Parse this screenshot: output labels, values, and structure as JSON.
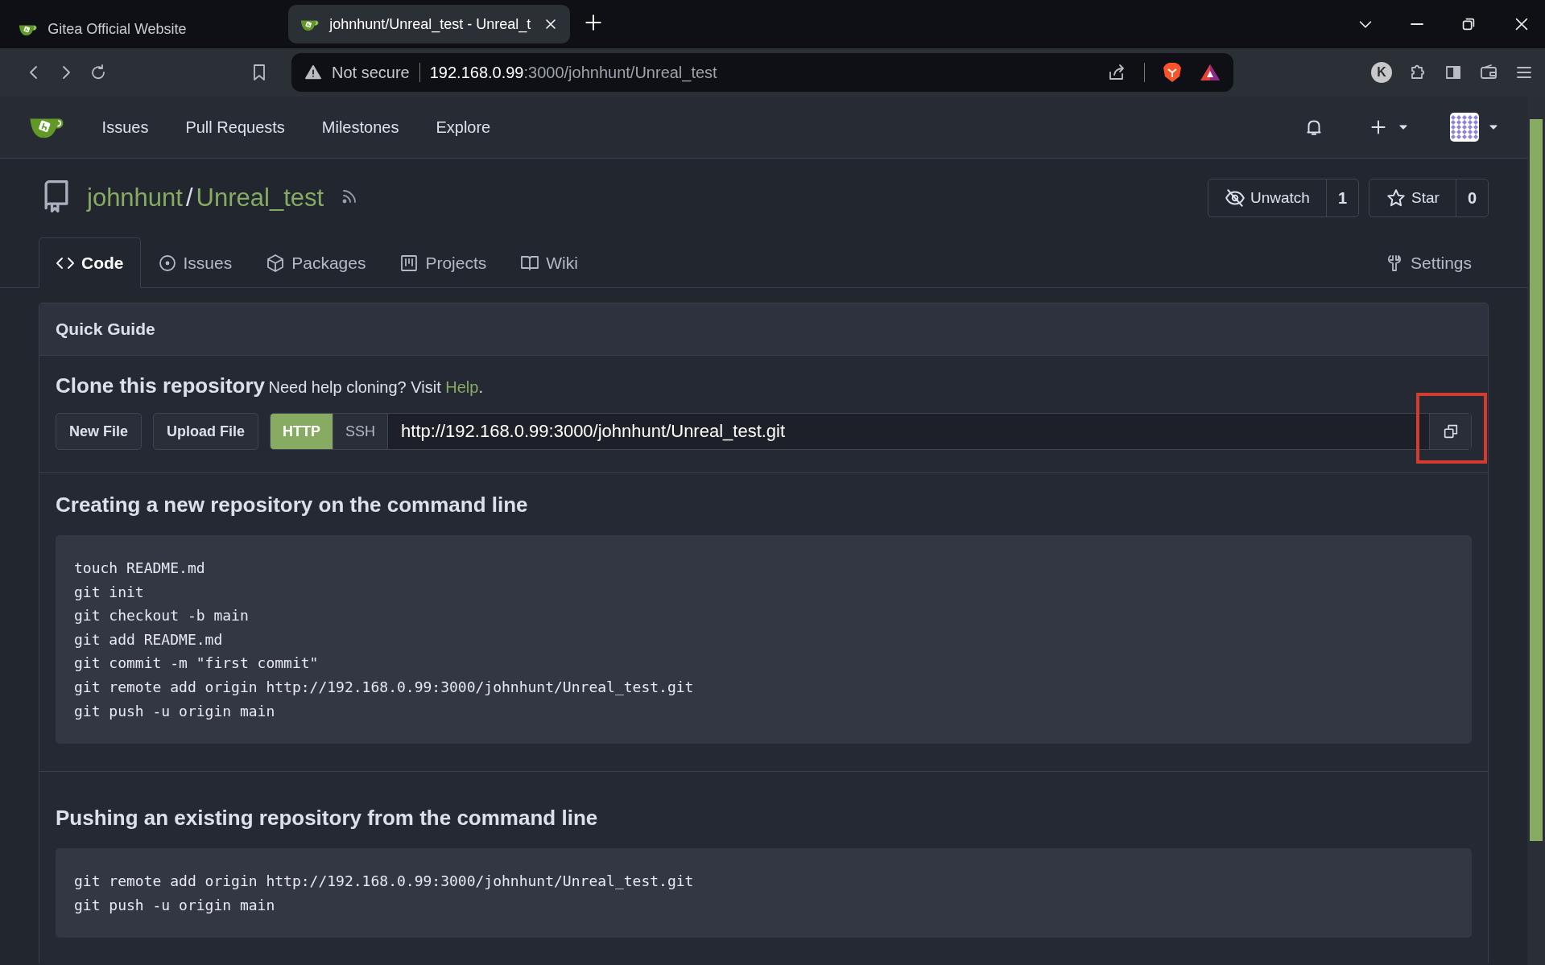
{
  "browser": {
    "tabs": [
      {
        "title": "Gitea Official Website",
        "selected": false
      },
      {
        "title": "johnhunt/Unreal_test - Unreal_t",
        "selected": true
      }
    ],
    "address": {
      "warning": "Not secure",
      "host": "192.168.0.99",
      "path": ":3000/johnhunt/Unreal_test"
    },
    "profile_initial": "K"
  },
  "navbar": {
    "items": [
      "Issues",
      "Pull Requests",
      "Milestones",
      "Explore"
    ]
  },
  "repo": {
    "owner": "johnhunt",
    "separator": "/",
    "name": "Unreal_test",
    "watch": {
      "label": "Unwatch",
      "count": "1"
    },
    "star": {
      "label": "Star",
      "count": "0"
    }
  },
  "tabs": [
    {
      "label": "Code",
      "selected": true
    },
    {
      "label": "Issues",
      "selected": false
    },
    {
      "label": "Packages",
      "selected": false
    },
    {
      "label": "Projects",
      "selected": false
    },
    {
      "label": "Wiki",
      "selected": false
    },
    {
      "label": "Settings",
      "selected": false
    }
  ],
  "quick_guide": {
    "title": "Quick Guide",
    "clone": {
      "title": "Clone this repository",
      "help_text": "Need help cloning? Visit",
      "help_link": "Help",
      "help_end": ".",
      "buttons": [
        "New File",
        "Upload File"
      ],
      "protocols": [
        {
          "label": "HTTP",
          "selected": true
        },
        {
          "label": "SSH",
          "selected": false
        }
      ],
      "url": "http://192.168.0.99:3000/johnhunt/Unreal_test.git",
      "copy_annotated": true
    },
    "sections": [
      {
        "title": "Creating a new repository on the command line",
        "code": [
          "touch README.md",
          "git init",
          "git checkout -b main",
          "git add README.md",
          "git commit -m \"first commit\"",
          "git remote add origin http://192.168.0.99:3000/johnhunt/Unreal_test.git",
          "git push -u origin main"
        ]
      },
      {
        "title": "Pushing an existing repository from the command line",
        "code": [
          "git remote add origin http://192.168.0.99:3000/johnhunt/Unreal_test.git",
          "git push -u origin main"
        ]
      }
    ]
  }
}
